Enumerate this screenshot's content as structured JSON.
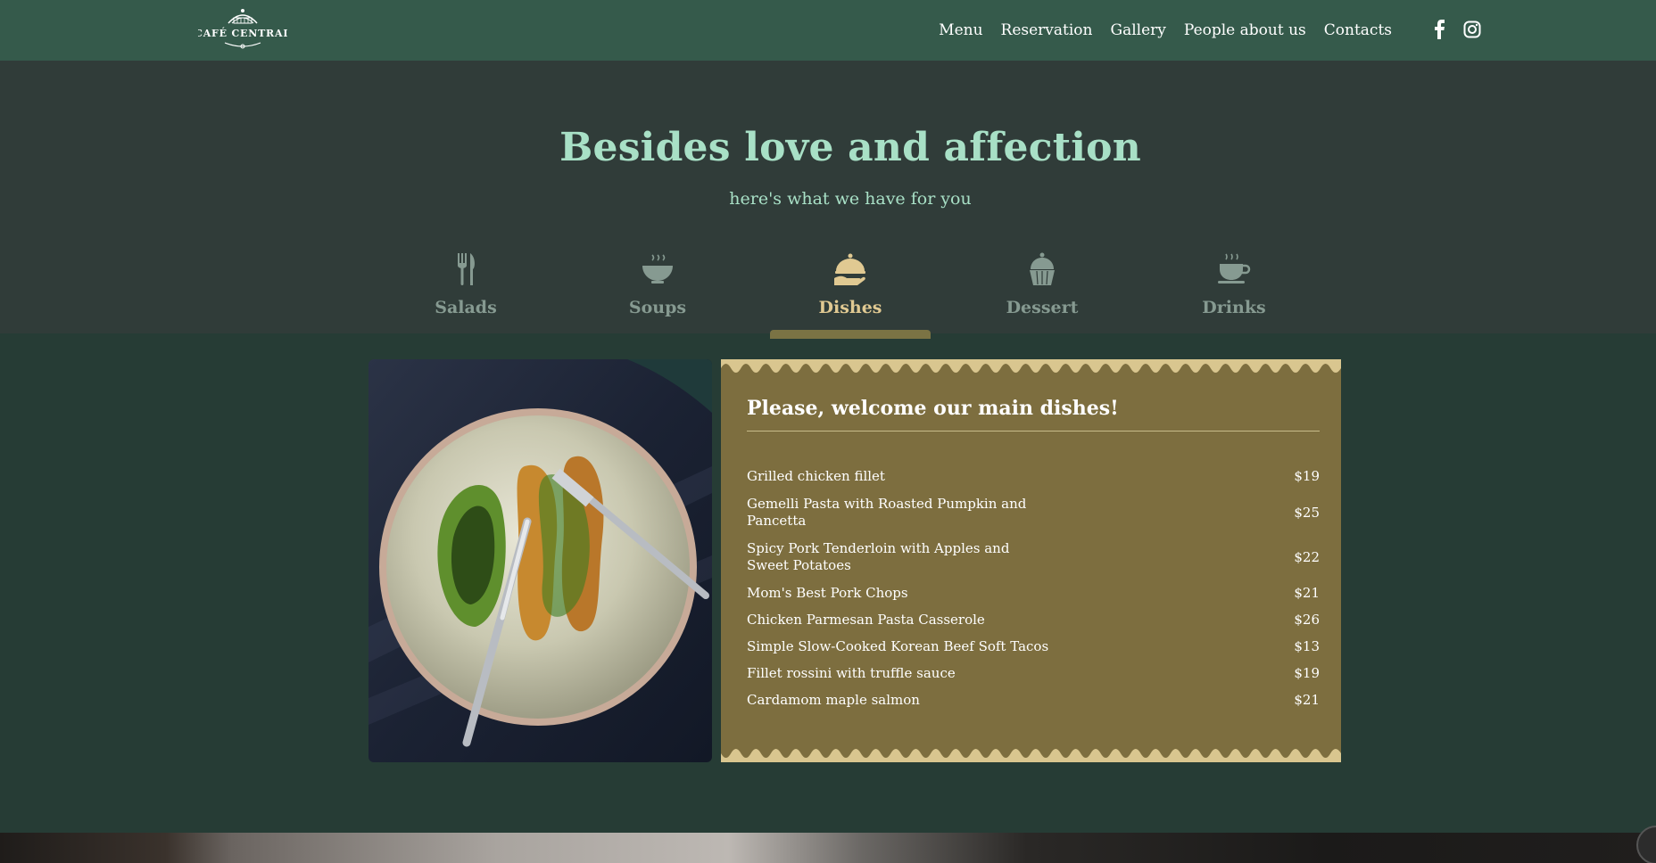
{
  "header": {
    "logo_text": "CAFÉ CENTRAL",
    "nav": [
      {
        "label": "Menu"
      },
      {
        "label": "Reservation"
      },
      {
        "label": "Gallery"
      },
      {
        "label": "People about us"
      },
      {
        "label": "Contacts"
      }
    ],
    "social": [
      "facebook-icon",
      "instagram-icon"
    ]
  },
  "hero": {
    "title": "Besides love and affection",
    "subtitle": "here's what we have for you"
  },
  "tabs": [
    {
      "label": "Salads",
      "icon": "cutlery-icon",
      "active": false
    },
    {
      "label": "Soups",
      "icon": "soup-bowl-icon",
      "active": false
    },
    {
      "label": "Dishes",
      "icon": "serving-cloche-icon",
      "active": true
    },
    {
      "label": "Dessert",
      "icon": "cupcake-icon",
      "active": false
    },
    {
      "label": "Drinks",
      "icon": "coffee-cup-icon",
      "active": false
    }
  ],
  "menu": {
    "title": "Please, welcome our main dishes!",
    "items": [
      {
        "name": "Grilled chicken fillet",
        "price": "$19"
      },
      {
        "name": "Gemelli Pasta with Roasted Pumpkin and Pancetta",
        "price": "$25"
      },
      {
        "name": "Spicy Pork Tenderloin with Apples and Sweet Potatoes",
        "price": "$22"
      },
      {
        "name": "Mom's Best Pork Chops",
        "price": "$21"
      },
      {
        "name": "Chicken Parmesan Pasta Casserole",
        "price": "$26"
      },
      {
        "name": "Simple Slow-Cooked Korean Beef Soft Tacos",
        "price": "$13"
      },
      {
        "name": "Fillet rossini with truffle sauce",
        "price": "$19"
      },
      {
        "name": "Cardamom maple salmon",
        "price": "$21"
      }
    ]
  },
  "colors": {
    "header_bg": "#355a4b",
    "hero_bg": "#303c39",
    "content_bg": "#263c35",
    "title_mint": "#a8e0c6",
    "active_gold": "#e0c992",
    "card_olive": "#7d6e3f",
    "scallop": "#d9c68f"
  }
}
